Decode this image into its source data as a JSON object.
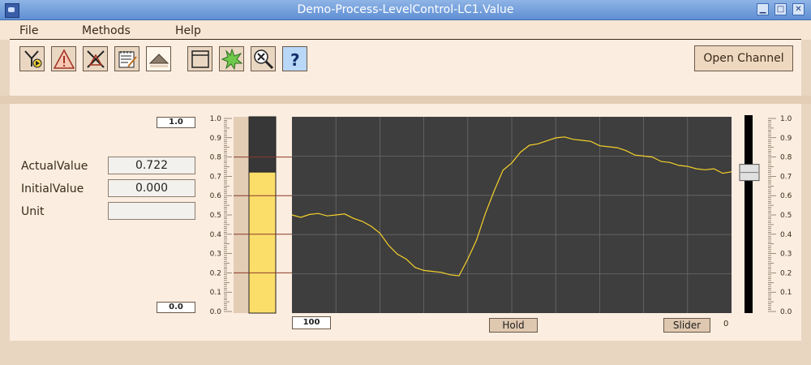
{
  "window": {
    "title": "Demo-Process-LevelControl-LC1.Value"
  },
  "menu": {
    "items": [
      "File",
      "Methods",
      "Help"
    ]
  },
  "toolbar": {
    "tools": [
      {
        "name": "trend-tool-icon"
      },
      {
        "name": "alarm-warning-icon"
      },
      {
        "name": "block-cross-icon"
      },
      {
        "name": "edit-notes-icon"
      },
      {
        "name": "eject-triangle-icon"
      },
      {
        "name": "window-icon"
      },
      {
        "name": "star-burst-icon"
      },
      {
        "name": "zoom-x-icon"
      },
      {
        "name": "help-question-icon"
      }
    ],
    "open_channel_label": "Open Channel"
  },
  "fields": {
    "actual_label": "ActualValue",
    "actual_value": "0.722",
    "initial_label": "InitialValue",
    "initial_value": "0.000",
    "unit_label": "Unit",
    "unit_value": ""
  },
  "bar": {
    "max_label": "1.0",
    "min_label": "0.0",
    "level": 0.722
  },
  "trend": {
    "time_range_label": "100",
    "hold_label": "Hold",
    "slider_label": "Slider",
    "slider_min_label": "0",
    "slider_value": 0.72,
    "y_ticks": [
      "1.0",
      "0.9",
      "0.8",
      "0.7",
      "0.6",
      "0.5",
      "0.4",
      "0.3",
      "0.2",
      "0.1",
      "0.0"
    ]
  },
  "colors": {
    "bar_fill": "#fbdd6a",
    "plot_bg": "#3e3e3e",
    "trace": "#f5d12a",
    "bar_empty": "#373737"
  },
  "chart_data": {
    "type": "line",
    "ylim": [
      0,
      1
    ],
    "series": [
      {
        "x": [
          0,
          2,
          4,
          6,
          8,
          10,
          12,
          14,
          16,
          18,
          20,
          22,
          24,
          26,
          28,
          30,
          32,
          34,
          36,
          38,
          40,
          42,
          44,
          46,
          48,
          50,
          52,
          54,
          56,
          58,
          60,
          62,
          64,
          66,
          68,
          70,
          72,
          74,
          76,
          78,
          80,
          82,
          84,
          86,
          88,
          90,
          92,
          94,
          96,
          98,
          100
        ],
        "values": [
          0.5,
          0.49,
          0.5,
          0.5,
          0.5,
          0.5,
          0.5,
          0.49,
          0.47,
          0.44,
          0.4,
          0.35,
          0.3,
          0.27,
          0.24,
          0.22,
          0.21,
          0.2,
          0.2,
          0.19,
          0.27,
          0.38,
          0.51,
          0.62,
          0.72,
          0.77,
          0.82,
          0.85,
          0.87,
          0.88,
          0.89,
          0.89,
          0.89,
          0.88,
          0.87,
          0.86,
          0.85,
          0.84,
          0.82,
          0.81,
          0.8,
          0.79,
          0.78,
          0.77,
          0.75,
          0.74,
          0.74,
          0.73,
          0.73,
          0.72,
          0.72
        ]
      }
    ]
  }
}
